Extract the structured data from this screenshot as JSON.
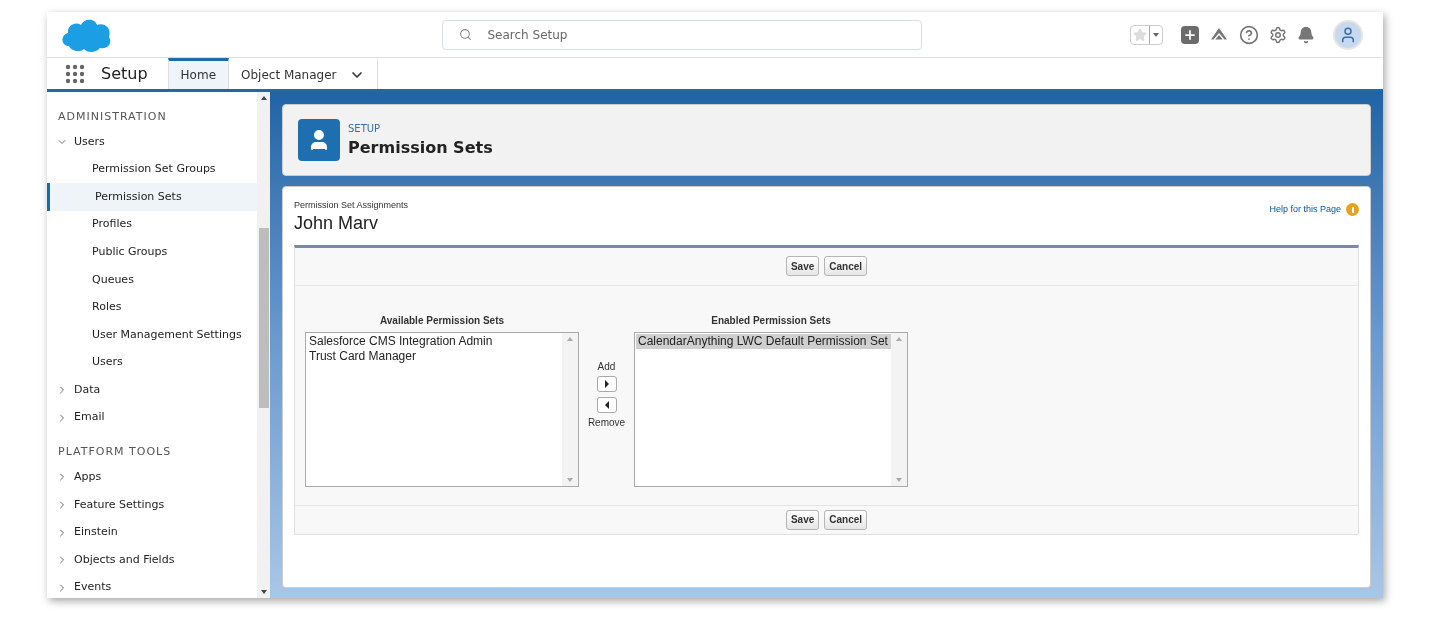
{
  "header": {
    "search": {
      "placeholder": "Search Setup"
    }
  },
  "nav": {
    "app_name": "Setup",
    "tabs": [
      {
        "label": "Home",
        "selected": true,
        "dropdown": false
      },
      {
        "label": "Object Manager",
        "selected": false,
        "dropdown": true
      }
    ]
  },
  "sidebar": {
    "sections": [
      {
        "heading": "ADMINISTRATION",
        "items": [
          {
            "label": "Users",
            "expanded": true,
            "children": [
              {
                "label": "Permission Set Groups",
                "selected": false
              },
              {
                "label": "Permission Sets",
                "selected": true
              },
              {
                "label": "Profiles",
                "selected": false
              },
              {
                "label": "Public Groups",
                "selected": false
              },
              {
                "label": "Queues",
                "selected": false
              },
              {
                "label": "Roles",
                "selected": false
              },
              {
                "label": "User Management Settings",
                "selected": false
              },
              {
                "label": "Users",
                "selected": false
              }
            ]
          },
          {
            "label": "Data",
            "expanded": false
          },
          {
            "label": "Email",
            "expanded": false
          }
        ]
      },
      {
        "heading": "PLATFORM TOOLS",
        "items": [
          {
            "label": "Apps",
            "expanded": false
          },
          {
            "label": "Feature Settings",
            "expanded": false
          },
          {
            "label": "Einstein",
            "expanded": false
          },
          {
            "label": "Objects and Fields",
            "expanded": false
          },
          {
            "label": "Events",
            "expanded": false
          }
        ]
      }
    ]
  },
  "page_header": {
    "eyebrow": "SETUP",
    "title": "Permission Sets"
  },
  "assignments": {
    "subtitle": "Permission Set Assignments",
    "name": "John Marv",
    "help_link": "Help for this Page",
    "buttons": [
      "Save",
      "Cancel"
    ],
    "available": {
      "label": "Available Permission Sets",
      "options": [
        {
          "label": "Salesforce CMS Integration Admin",
          "selected": false
        },
        {
          "label": "Trust Card Manager",
          "selected": false
        }
      ]
    },
    "add": {
      "label": "Add"
    },
    "remove": {
      "label": "Remove"
    },
    "enabled": {
      "label": "Enabled Permission Sets",
      "options": [
        {
          "label": "CalendarAnything LWC Default Permission Set",
          "selected": true
        }
      ]
    },
    "bottom_buttons": [
      "Save",
      "Cancel"
    ]
  }
}
